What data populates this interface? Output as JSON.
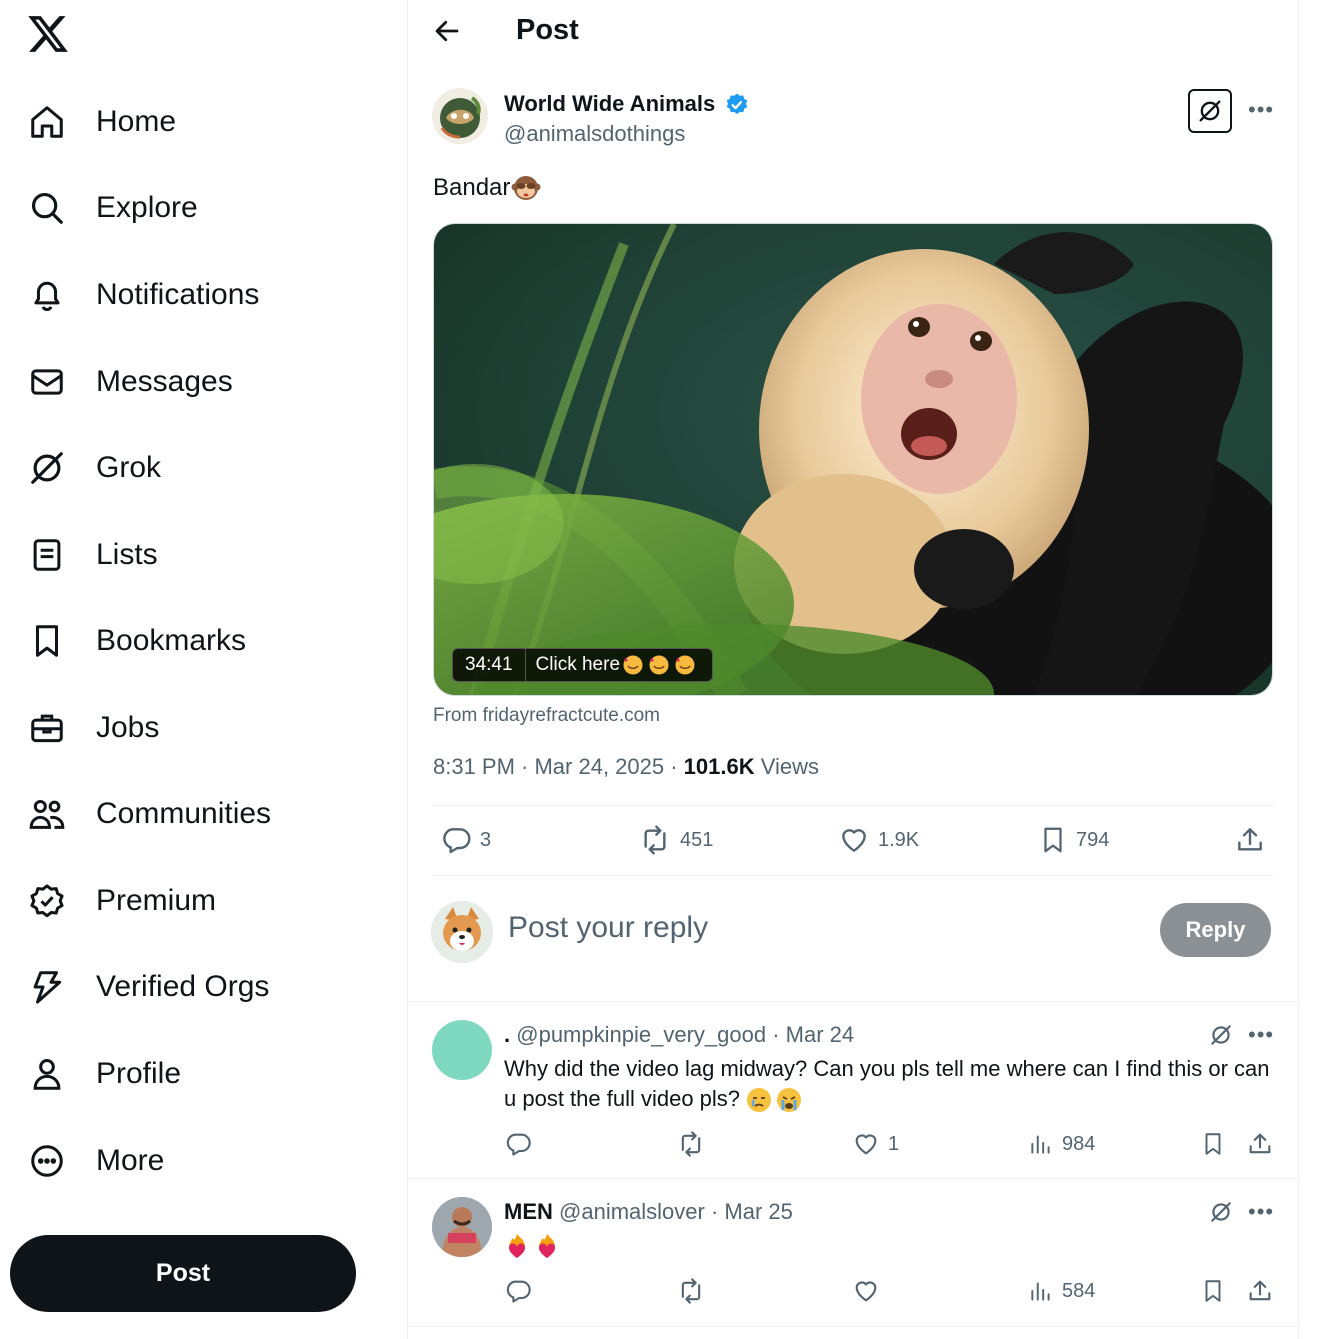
{
  "sidebar": {
    "items": [
      {
        "label": "Home",
        "icon": "home-icon"
      },
      {
        "label": "Explore",
        "icon": "search-icon"
      },
      {
        "label": "Notifications",
        "icon": "bell-icon"
      },
      {
        "label": "Messages",
        "icon": "envelope-icon"
      },
      {
        "label": "Grok",
        "icon": "grok-icon"
      },
      {
        "label": "Lists",
        "icon": "list-icon"
      },
      {
        "label": "Bookmarks",
        "icon": "bookmark-icon"
      },
      {
        "label": "Jobs",
        "icon": "briefcase-icon"
      },
      {
        "label": "Communities",
        "icon": "people-icon"
      },
      {
        "label": "Premium",
        "icon": "verified-badge-icon"
      },
      {
        "label": "Verified Orgs",
        "icon": "lightning-icon"
      },
      {
        "label": "Profile",
        "icon": "person-icon"
      },
      {
        "label": "More",
        "icon": "more-circle-icon"
      }
    ],
    "post_button": "Post"
  },
  "header": {
    "title": "Post"
  },
  "post": {
    "author_name": "World Wide Animals",
    "author_handle": "@animalsdothings",
    "text": "Bandar",
    "media": {
      "duration": "34:41",
      "cta": "Click here",
      "source": "From fridayrefractcute.com"
    },
    "time": "8:31 PM · Mar 24, 2025 · ",
    "views_count": "101.6K",
    "views_label": " Views",
    "stats": {
      "replies": "3",
      "reposts": "451",
      "likes": "1.9K",
      "bookmarks": "794"
    }
  },
  "composer": {
    "placeholder": "Post your reply",
    "reply_button": "Reply"
  },
  "comments": [
    {
      "name": ".",
      "handle": "@pumpkinpie_very_good",
      "date": "· Mar 24",
      "text": "Why did the video lag midway? Can you pls tell me where can I find this or can u post the full video pls?",
      "replies": "",
      "reposts": "",
      "likes": "1",
      "views": "984",
      "avatar_color": "#7fd8c0"
    },
    {
      "name": "MEN",
      "handle": "@animalslover",
      "date": "· Mar 25",
      "text": "",
      "replies": "",
      "reposts": "",
      "likes": "",
      "views": "584"
    }
  ],
  "colors": {
    "accent": "#1d9bf0",
    "text": "#0f1419",
    "muted": "#536471",
    "border": "#eff3f4"
  }
}
